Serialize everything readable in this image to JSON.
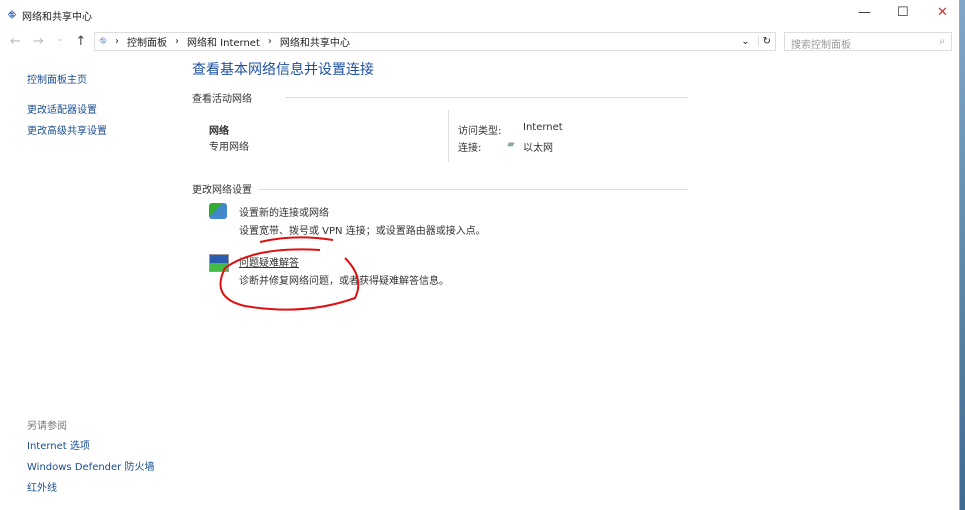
{
  "window": {
    "title": "网络和共享中心"
  },
  "breadcrumb": [
    "控制面板",
    "网络和 Internet",
    "网络和共享中心"
  ],
  "search": {
    "placeholder": "搜索控制面板"
  },
  "sidebar": {
    "home": "控制面板主页",
    "items": [
      "更改适配器设置",
      "更改高级共享设置"
    ],
    "see_also": "另请参阅",
    "links": [
      "Internet 选项",
      "Windows Defender 防火墙",
      "红外线"
    ]
  },
  "main": {
    "title": "查看基本网络信息并设置连接",
    "active_header": "查看活动网络",
    "network_name": "网络",
    "network_type": "专用网络",
    "access_label": "访问类型:",
    "access_value": "Internet",
    "conn_label": "连接:",
    "conn_value": "以太网",
    "change_header": "更改网络设置",
    "tasks": [
      {
        "title": "设置新的连接或网络",
        "desc": "设置宽带、拨号或 VPN 连接；或设置路由器或接入点。"
      },
      {
        "title": "问题疑难解答",
        "desc": "诊断并修复网络问题，或者获得疑难解答信息。"
      }
    ]
  }
}
